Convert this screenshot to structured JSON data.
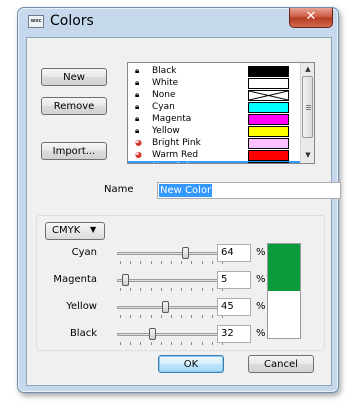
{
  "window": {
    "title": "Colors",
    "app_icon_text": "wxc",
    "close_label": "✕"
  },
  "buttons": {
    "new": "New",
    "remove": "Remove",
    "import": "Import...",
    "ok": "OK",
    "cancel": "Cancel"
  },
  "color_list": {
    "items": [
      {
        "name": "Black",
        "swatch": "#000000",
        "locked": true
      },
      {
        "name": "White",
        "swatch": "#ffffff",
        "locked": true
      },
      {
        "name": "None",
        "swatch": "none",
        "locked": true
      },
      {
        "name": "Cyan",
        "swatch": "#00ffff",
        "locked": true
      },
      {
        "name": "Magenta",
        "swatch": "#ff00ff",
        "locked": true
      },
      {
        "name": "Yellow",
        "swatch": "#ffff00",
        "locked": true
      },
      {
        "name": "Bright Pink",
        "swatch": "#ffc0ff",
        "locked": false
      },
      {
        "name": "Warm Red",
        "swatch": "#ff0000",
        "locked": false
      },
      {
        "name": "New Color",
        "swatch": "#0b9b3c",
        "locked": false,
        "selected": true
      }
    ]
  },
  "name_field": {
    "label": "Name",
    "value": "New Color"
  },
  "color_model": {
    "selected": "CMYK"
  },
  "channels": [
    {
      "label": "Cyan",
      "value": "64",
      "unit": "%",
      "level": 0.64
    },
    {
      "label": "Magenta",
      "value": "5",
      "unit": "%",
      "level": 0.05
    },
    {
      "label": "Yellow",
      "value": "45",
      "unit": "%",
      "level": 0.45
    },
    {
      "label": "Black",
      "value": "32",
      "unit": "%",
      "level": 0.32
    }
  ],
  "preview": {
    "new_color": "#0b9b3c",
    "old_color": "#ffffff"
  },
  "accent": "#3399ff"
}
